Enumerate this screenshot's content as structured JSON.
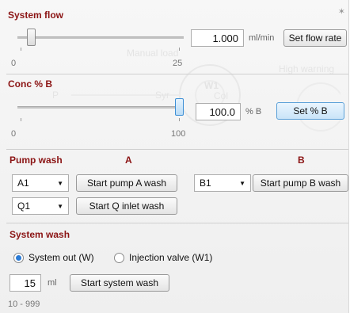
{
  "system_flow": {
    "title": "System flow",
    "value": "1.000",
    "unit": "ml/min",
    "button": "Set flow rate",
    "range_min": "0",
    "range_max": "25",
    "slider_value": 1.0
  },
  "conc_b": {
    "title": "Conc % B",
    "value": "100.0",
    "unit": "% B",
    "button": "Set % B",
    "range_min": "0",
    "range_max": "100",
    "slider_value": 100.0
  },
  "pump_wash": {
    "title": "Pump wash",
    "col_a": "A",
    "col_b": "B",
    "a_select": "A1",
    "a_button": "Start pump A wash",
    "b_select": "B1",
    "b_button": "Start pump B wash",
    "q_select": "Q1",
    "q_button": "Start Q inlet wash"
  },
  "system_wash": {
    "title": "System wash",
    "option_1": "System out (W)",
    "option_2": "Injection valve (W1)",
    "selected": "System out (W)",
    "volume": "15",
    "unit": "ml",
    "button": "Start system wash",
    "range": "10 - 999"
  },
  "background_ghost": {
    "manual_load": "Manual load",
    "high_warn": "High warning",
    "w1": "W1",
    "col": "Col",
    "syr": "Syr",
    "p": "P"
  },
  "icons": {
    "pin": "pin-icon"
  }
}
